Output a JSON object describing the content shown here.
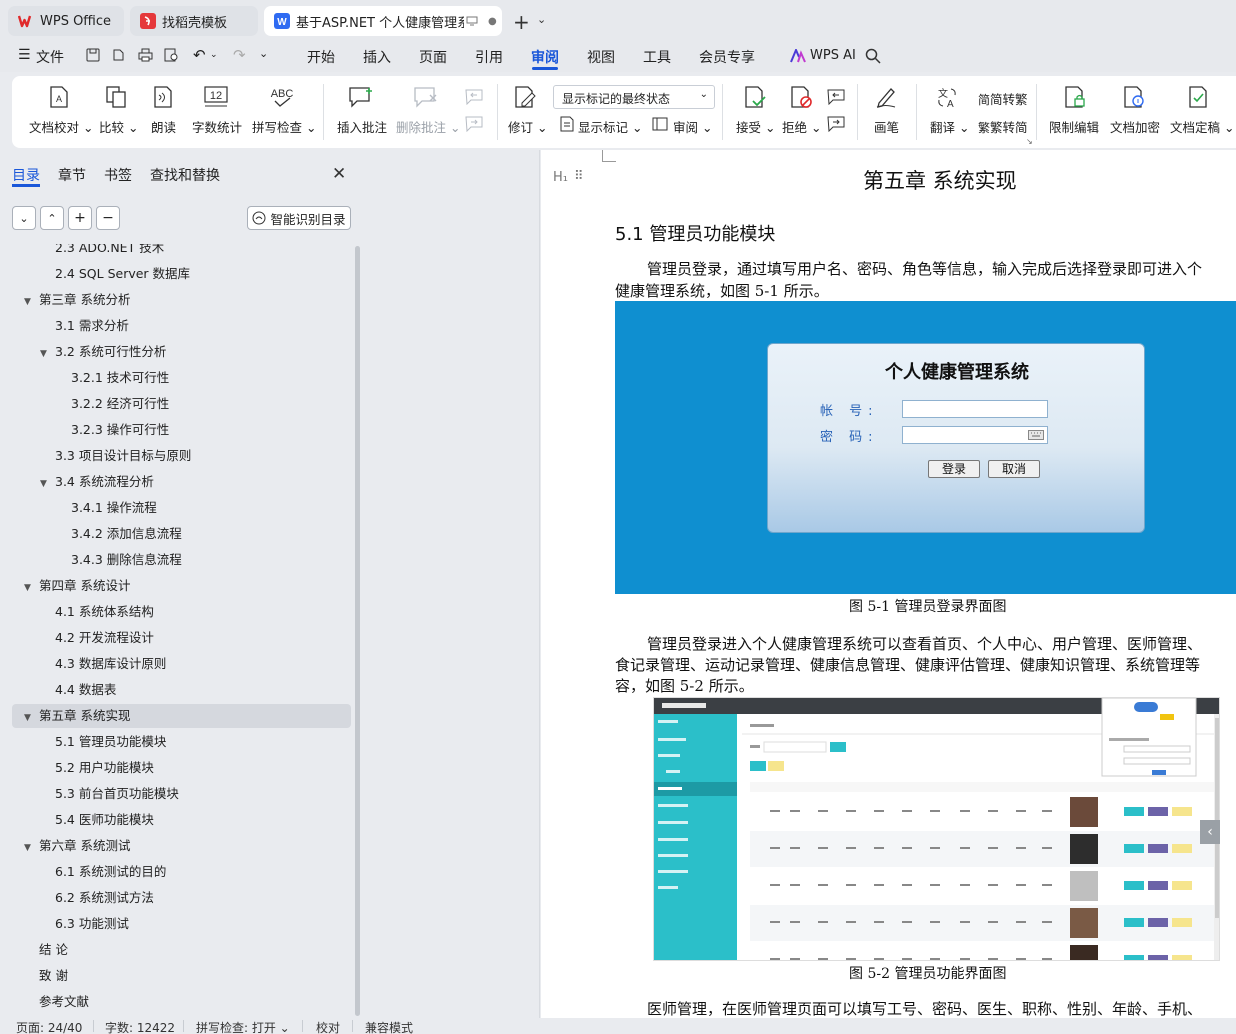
{
  "tabs": [
    {
      "label": "WPS Office",
      "icon": "wps-logo-icon"
    },
    {
      "label": "找稻壳模板",
      "icon": "docer-logo-icon"
    },
    {
      "label": "基于ASP.NET 个人健康管理系",
      "icon": "word-doc-icon",
      "active": true
    }
  ],
  "menu": {
    "file": "文件",
    "items": [
      "开始",
      "插入",
      "页面",
      "引用",
      "审阅",
      "视图",
      "工具",
      "会员专享"
    ],
    "selected": "审阅",
    "wps_ai": "WPS AI"
  },
  "ribbon": {
    "doc_check": "文档校对",
    "compare": "比较",
    "read_aloud": "朗读",
    "word_count": "字数统计",
    "spell_check": "拼写检查",
    "insert_comment": "插入批注",
    "delete_comment": "删除批注",
    "track_changes": "修订",
    "markup_select": "显示标记的最终状态",
    "show_markup": "显示标记",
    "review": "审阅",
    "accept": "接受",
    "reject": "拒绝",
    "pen": "画笔",
    "translate": "翻译",
    "to_traditional": "简转繁",
    "to_simplified": "繁转简",
    "restrict_edit": "限制编辑",
    "encrypt": "文档加密",
    "finalize": "文档定稿",
    "icon_abc": "ABC",
    "icon_12": "12"
  },
  "nav": {
    "tabs": [
      "目录",
      "章节",
      "书签",
      "查找和替换"
    ],
    "smart_toc": "智能识别目录",
    "toc": [
      {
        "label": "2.3 ADO.NET 技术",
        "level": 1
      },
      {
        "label": "2.4 SQL Server 数据库",
        "level": 1
      },
      {
        "label": "第三章 系统分析",
        "level": 0,
        "expanded": true
      },
      {
        "label": "3.1 需求分析",
        "level": 1
      },
      {
        "label": "3.2 系统可行性分析",
        "level": 1,
        "expanded": true
      },
      {
        "label": "3.2.1 技术可行性",
        "level": 2
      },
      {
        "label": "3.2.2 经济可行性",
        "level": 2
      },
      {
        "label": "3.2.3 操作可行性",
        "level": 2
      },
      {
        "label": "3.3 项目设计目标与原则",
        "level": 1
      },
      {
        "label": "3.4 系统流程分析",
        "level": 1,
        "expanded": true
      },
      {
        "label": "3.4.1 操作流程",
        "level": 2
      },
      {
        "label": "3.4.2 添加信息流程",
        "level": 2
      },
      {
        "label": "3.4.3 删除信息流程",
        "level": 2
      },
      {
        "label": "第四章 系统设计",
        "level": 0,
        "expanded": true
      },
      {
        "label": "4.1 系统体系结构",
        "level": 1
      },
      {
        "label": "4.2 开发流程设计",
        "level": 1
      },
      {
        "label": "4.3 数据库设计原则",
        "level": 1
      },
      {
        "label": "4.4 数据表",
        "level": 1
      },
      {
        "label": "第五章 系统实现",
        "level": 0,
        "expanded": true,
        "selected": true
      },
      {
        "label": "5.1 管理员功能模块",
        "level": 1
      },
      {
        "label": "5.2 用户功能模块",
        "level": 1
      },
      {
        "label": "5.3 前台首页功能模块",
        "level": 1
      },
      {
        "label": "5.4 医师功能模块",
        "level": 1
      },
      {
        "label": "第六章 系统测试",
        "level": 0,
        "expanded": true
      },
      {
        "label": "6.1 系统测试的目的",
        "level": 1
      },
      {
        "label": "6.2 系统测试方法",
        "level": 1
      },
      {
        "label": "6.3 功能测试",
        "level": 1
      },
      {
        "label": "结 论",
        "level": 0
      },
      {
        "label": "致 谢",
        "level": 0
      },
      {
        "label": "参考文献",
        "level": 0
      }
    ]
  },
  "doc": {
    "heading_marker": "H₁",
    "chapter_title": "第五章 系统实现",
    "section_title": "5.1 管理员功能模块",
    "para1_line1": "管理员登录，通过填写用户名、密码、角色等信息，输入完成后选择登录即可进入个",
    "para1_line2": "健康管理系统，如图 5-1 所示。",
    "fig1": {
      "title": "个人健康管理系统",
      "account_label": "帐 号:",
      "password_label": "密 码:",
      "login_btn": "登录",
      "cancel_btn": "取消"
    },
    "fig1_caption": "图 5-1 管理员登录界面图",
    "para2_line1": "管理员登录进入个人健康管理系统可以查看首页、个人中心、用户管理、医师管理、",
    "para2_line2": "食记录管理、运动记录管理、健康信息管理、健康评估管理、健康知识管理、系统管理等",
    "para2_line3": "容，如图 5-2 所示。",
    "fig2_caption": "图 5-2 管理员功能界面图",
    "para3_line1": "医师管理，在医师管理页面可以填写工号、密码、医生、职称、性别、年龄、手机、"
  },
  "status": {
    "page": "页面: 24/40",
    "words": "字数: 12422",
    "spell": "拼写检查: 打开",
    "proof": "校对",
    "compat": "兼容模式"
  },
  "colors": {
    "accent": "#1a57d9",
    "fig1_bg": "#0f8fd0",
    "fig2_sidebar": "#2bbfc9"
  }
}
